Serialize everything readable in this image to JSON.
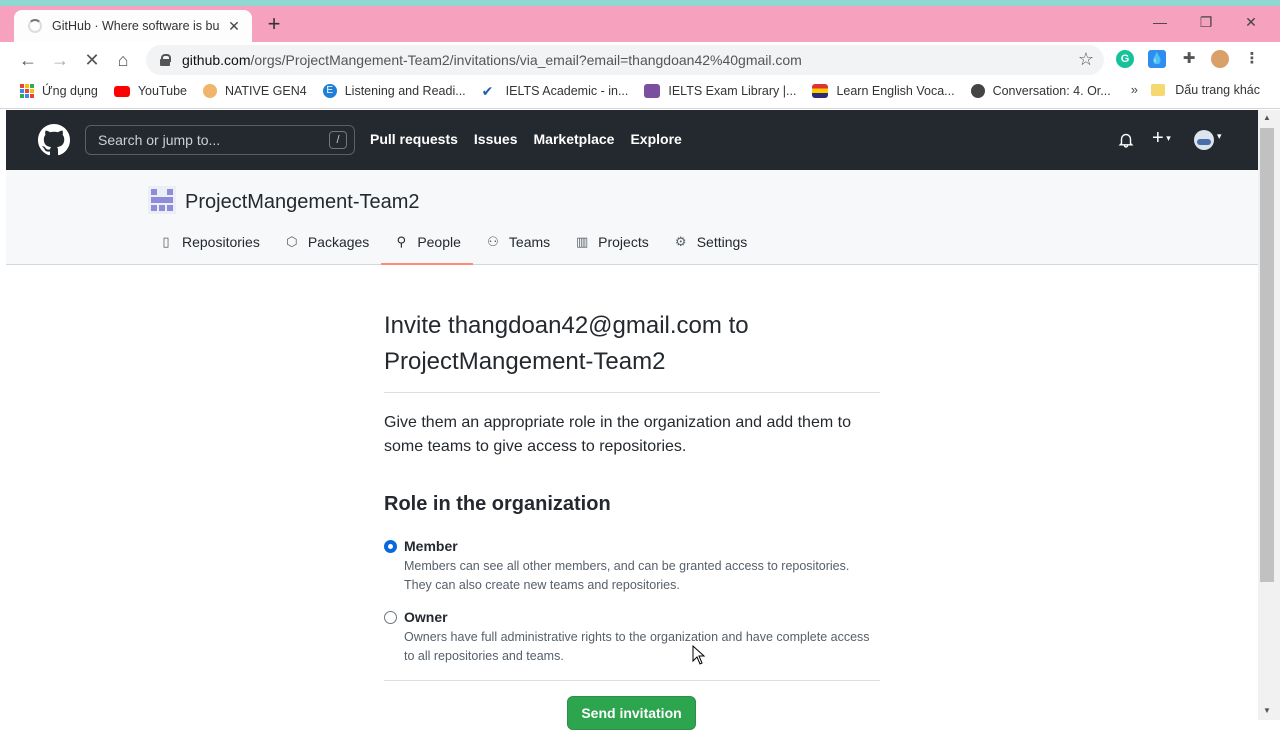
{
  "browser": {
    "tab_title": "GitHub · Where software is built",
    "url_host": "github.com",
    "url_path": "/orgs/ProjectMangement-Team2/invitations/via_email?email=thangdoan42%40gmail.com",
    "bookmarks": [
      {
        "label": "Ứng dụng",
        "icon": "apps-grid-icon",
        "color": "#ea4335"
      },
      {
        "label": "YouTube",
        "icon": "youtube-icon",
        "color": "#ff0000"
      },
      {
        "label": "NATIVE GEN4",
        "icon": "native-gen4-icon",
        "color": "#f0b46b"
      },
      {
        "label": "Listening and Readi...",
        "icon": "e-circle-icon",
        "color": "#1f7ed8"
      },
      {
        "label": "IELTS Academic - in...",
        "icon": "check-icon",
        "color": "#1d5fa8"
      },
      {
        "label": "IELTS Exam Library |...",
        "icon": "ielts-library-icon",
        "color": "#7b4fa0"
      },
      {
        "label": "Learn English Voca...",
        "icon": "flag-icon",
        "color": "#2b2b7a"
      },
      {
        "label": "Conversation: 4. Or...",
        "icon": "globe-icon",
        "color": "#444444"
      }
    ],
    "other_bookmarks": "Dấu trang khác"
  },
  "github": {
    "search_placeholder": "Search or jump to...",
    "search_shortcut": "/",
    "nav": [
      "Pull requests",
      "Issues",
      "Marketplace",
      "Explore"
    ]
  },
  "org": {
    "name": "ProjectMangement-Team2",
    "tabs": [
      {
        "label": "Repositories",
        "icon": "repo-icon"
      },
      {
        "label": "Packages",
        "icon": "package-icon"
      },
      {
        "label": "People",
        "icon": "person-icon",
        "active": true
      },
      {
        "label": "Teams",
        "icon": "people-icon"
      },
      {
        "label": "Projects",
        "icon": "project-icon"
      },
      {
        "label": "Settings",
        "icon": "gear-icon"
      }
    ]
  },
  "invite": {
    "title": "Invite thangdoan42@gmail.com to ProjectMangement-Team2",
    "lead": "Give them an appropriate role in the organization and add them to some teams to give access to repositories.",
    "role_heading": "Role in the organization",
    "roles": [
      {
        "name": "Member",
        "desc": "Members can see all other members, and can be granted access to repositories. They can also create new teams and repositories.",
        "checked": true
      },
      {
        "name": "Owner",
        "desc": "Owners have full administrative rights to the organization and have complete access to all repositories and teams.",
        "checked": false
      }
    ],
    "send_label": "Send invitation"
  },
  "colors": {
    "tabbar": "#f6a1bd",
    "header": "#24292f",
    "primary_button": "#2da44e",
    "active_tab_underline": "#fd8c73",
    "radio_checked": "#0969da"
  }
}
